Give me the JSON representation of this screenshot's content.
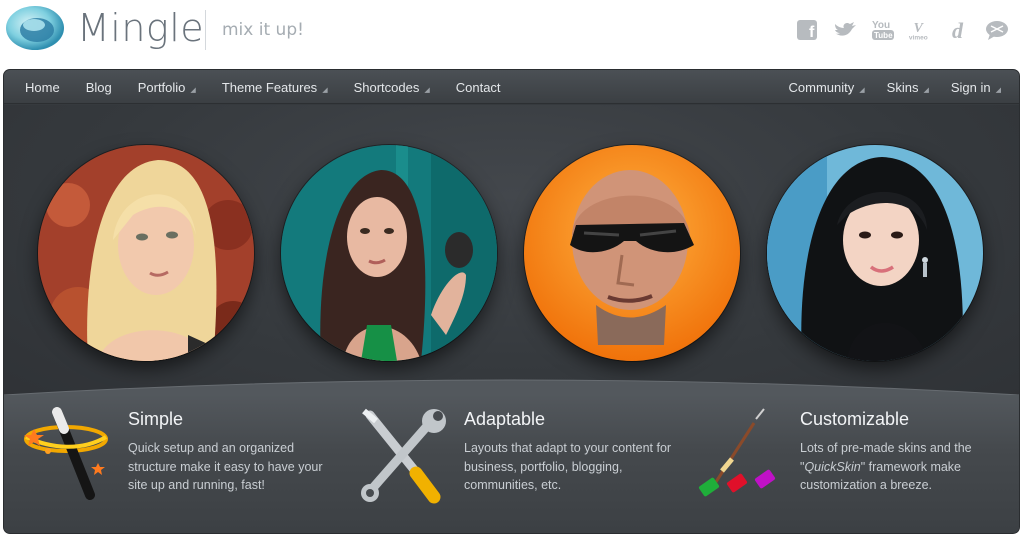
{
  "header": {
    "brand": "Mingle",
    "tagline": "mix it up!",
    "socials": [
      {
        "icon": "facebook-icon",
        "glyph": "f"
      },
      {
        "icon": "twitter-icon",
        "glyph": "❦"
      },
      {
        "icon": "youtube-icon",
        "glyph": "You"
      },
      {
        "icon": "vimeo-icon",
        "glyph": "V"
      },
      {
        "icon": "delicious-icon",
        "glyph": "d"
      },
      {
        "icon": "chat-icon",
        "glyph": "✉"
      }
    ]
  },
  "nav": {
    "left": [
      {
        "label": "Home",
        "dropdown": false
      },
      {
        "label": "Blog",
        "dropdown": false
      },
      {
        "label": "Portfolio",
        "dropdown": true
      },
      {
        "label": "Theme Features",
        "dropdown": true
      },
      {
        "label": "Shortcodes",
        "dropdown": true
      },
      {
        "label": "Contact",
        "dropdown": false
      }
    ],
    "right": [
      {
        "label": "Community",
        "dropdown": true
      },
      {
        "label": "Skins",
        "dropdown": true
      },
      {
        "label": "Sign in",
        "dropdown": true
      }
    ]
  },
  "portraits": [
    {
      "name": "portrait-blonde-woman",
      "bg": "#a3402b"
    },
    {
      "name": "portrait-brunette-woman",
      "bg": "#1a7b7a"
    },
    {
      "name": "portrait-man-sunglasses",
      "bg": "#ff8a12"
    },
    {
      "name": "portrait-asian-woman",
      "bg": "#6fb8d9"
    }
  ],
  "features": [
    {
      "title": "Simple",
      "icon": "magic-wand-icon",
      "text": "Quick setup and an organized structure make it easy to have your site up and running, fast!"
    },
    {
      "title": "Adaptable",
      "icon": "tools-icon",
      "text": "Layouts that adapt to your content for business, portfolio, blogging, communities, etc."
    },
    {
      "title": "Customizable",
      "icon": "paintbrush-icon",
      "text_before": "Lots of pre-made skins and the \"",
      "text_em": "QuickSkin",
      "text_after": "\" framework make customization a breeze."
    }
  ],
  "colors": {
    "frame": "#363a3e",
    "nav_text": "#e4e7ea",
    "feature_title": "#f2f4f6",
    "feature_text": "#c9ced3"
  }
}
